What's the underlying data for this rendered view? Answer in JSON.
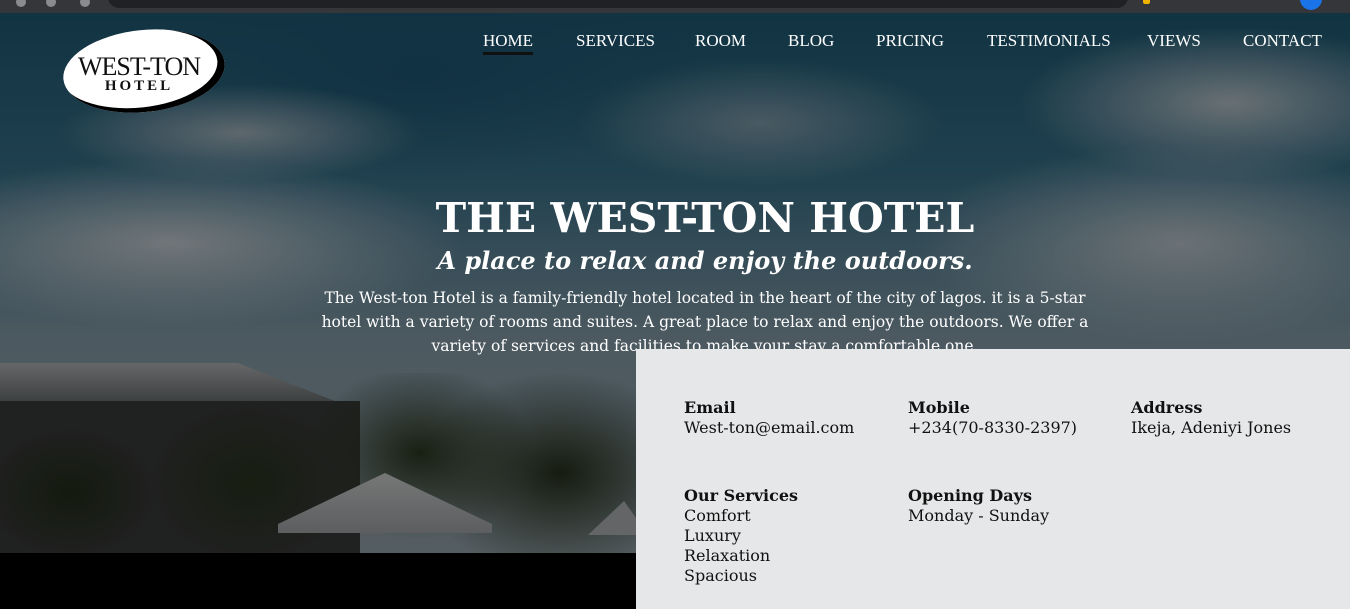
{
  "nav": {
    "items": [
      "HOME",
      "SERVICES",
      "ROOM",
      "BLOG",
      "PRICING",
      "TESTIMONIALS",
      "VIEWS",
      "CONTACT"
    ],
    "active": "HOME"
  },
  "logo": {
    "line1": "WEST-TON",
    "line2": "HOTEL"
  },
  "hero": {
    "title": "THE WEST-TON HOTEL",
    "subtitle": "A place to relax and enjoy the outdoors.",
    "description": "The West-ton Hotel is a family-friendly hotel located in the heart of the city of lagos. it is a 5-star hotel with a variety of rooms and suites. A great place to relax and enjoy the outdoors. We offer a variety of services and facilities to make your stay a comfortable one."
  },
  "info": {
    "email": {
      "label": "Email",
      "value": "West-ton@email.com"
    },
    "mobile": {
      "label": "Mobile",
      "value": "+234(70-8330-2397)"
    },
    "address": {
      "label": "Address",
      "value": "Ikeja, Adeniyi Jones"
    },
    "services": {
      "label": "Our Services",
      "items": [
        "Comfort",
        "Luxury",
        "Relaxation",
        "Spacious"
      ]
    },
    "opening": {
      "label": "Opening Days",
      "value": "Monday - Sunday"
    }
  },
  "colors": {
    "panel": "#e6e7e8",
    "nav_text": "#ffffff",
    "active_underline": "#111111"
  }
}
